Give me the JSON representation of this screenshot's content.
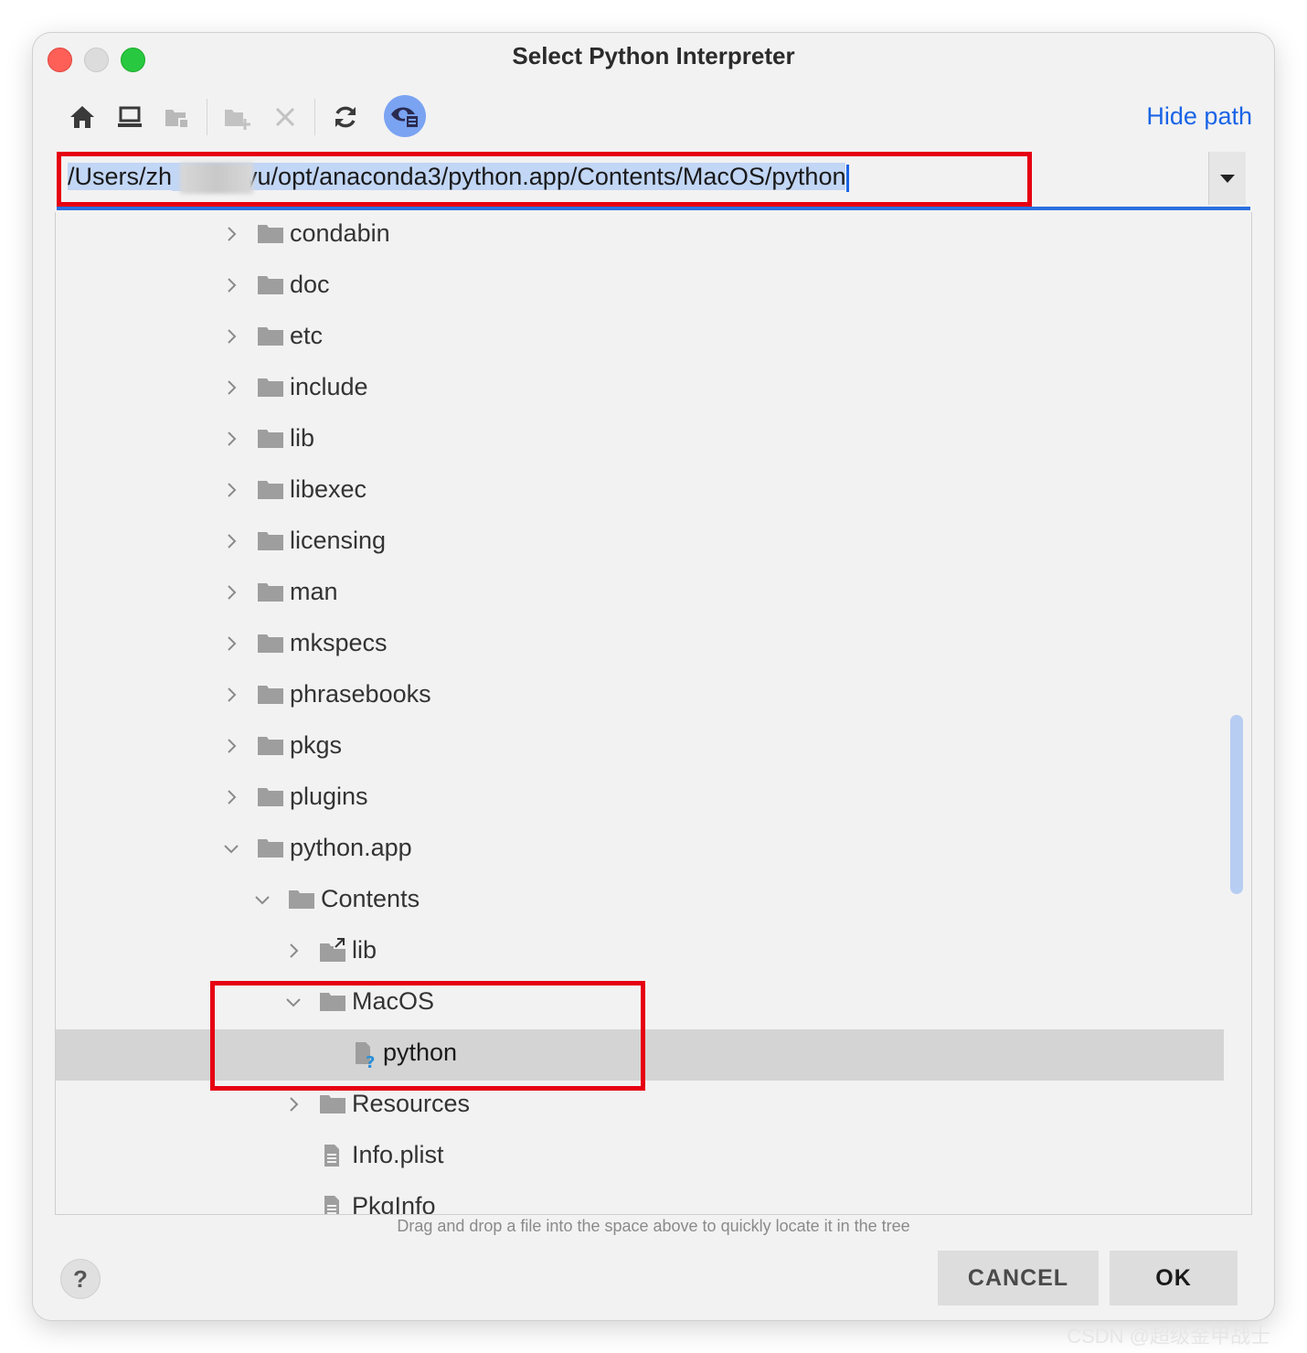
{
  "window": {
    "title": "Select Python Interpreter"
  },
  "toolbar": {
    "buttons": [
      {
        "icon": "home-icon"
      },
      {
        "icon": "desktop-icon"
      },
      {
        "icon": "project-folder-icon"
      },
      {
        "icon": "new-folder-icon"
      },
      {
        "icon": "delete-icon"
      },
      {
        "icon": "refresh-icon"
      },
      {
        "icon": "show-hidden-files-icon"
      }
    ],
    "hide_path_label": "Hide path"
  },
  "path": {
    "value_start": "/Users/zh",
    "value_end": "yu/opt/anaconda3/python.app/Contents/MacOS/python"
  },
  "tree": {
    "items": [
      {
        "label": "condabin",
        "type": "folder",
        "depth": 0,
        "expanded": false
      },
      {
        "label": "doc",
        "type": "folder",
        "depth": 0,
        "expanded": false
      },
      {
        "label": "etc",
        "type": "folder",
        "depth": 0,
        "expanded": false
      },
      {
        "label": "include",
        "type": "folder",
        "depth": 0,
        "expanded": false
      },
      {
        "label": "lib",
        "type": "folder",
        "depth": 0,
        "expanded": false
      },
      {
        "label": "libexec",
        "type": "folder",
        "depth": 0,
        "expanded": false
      },
      {
        "label": "licensing",
        "type": "folder",
        "depth": 0,
        "expanded": false
      },
      {
        "label": "man",
        "type": "folder",
        "depth": 0,
        "expanded": false
      },
      {
        "label": "mkspecs",
        "type": "folder",
        "depth": 0,
        "expanded": false
      },
      {
        "label": "phrasebooks",
        "type": "folder",
        "depth": 0,
        "expanded": false
      },
      {
        "label": "pkgs",
        "type": "folder",
        "depth": 0,
        "expanded": false
      },
      {
        "label": "plugins",
        "type": "folder",
        "depth": 0,
        "expanded": false
      },
      {
        "label": "python.app",
        "type": "folder",
        "depth": 0,
        "expanded": true
      },
      {
        "label": "Contents",
        "type": "folder",
        "depth": 1,
        "expanded": true
      },
      {
        "label": "lib",
        "type": "folder-link",
        "depth": 2,
        "expanded": false
      },
      {
        "label": "MacOS",
        "type": "folder",
        "depth": 2,
        "expanded": true
      },
      {
        "label": "python",
        "type": "unknown-file",
        "depth": 3,
        "selected": true
      },
      {
        "label": "Resources",
        "type": "folder",
        "depth": 2,
        "expanded": false
      },
      {
        "label": "Info.plist",
        "type": "text-file",
        "depth": 2
      },
      {
        "label": "PkgInfo",
        "type": "text-file",
        "depth": 2
      }
    ]
  },
  "hint": "Drag and drop a file into the space above to quickly locate it in the tree",
  "footer": {
    "help_label": "?",
    "cancel_label": "CANCEL",
    "ok_label": "OK"
  },
  "watermark": "CSDN @超级金甲战士",
  "colors": {
    "accent": "#1a64e6",
    "annotation_red": "#e60012",
    "selection": "#d4d4d4"
  }
}
